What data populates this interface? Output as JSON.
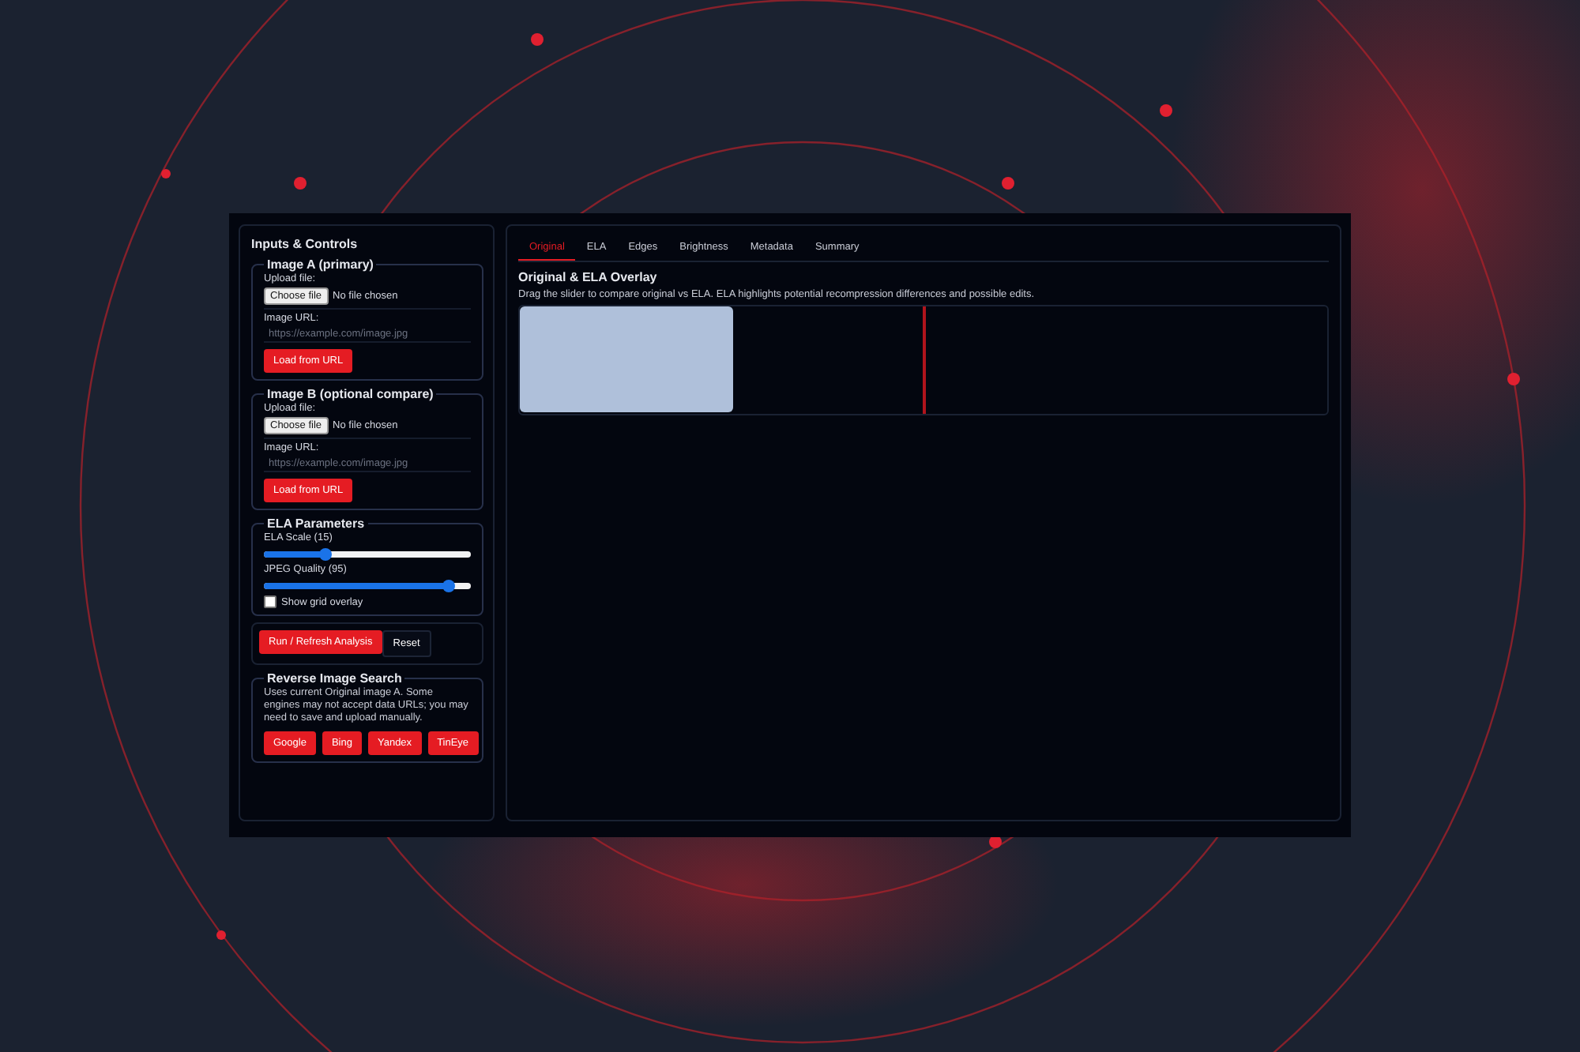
{
  "sidebar": {
    "title": "Inputs & Controls",
    "sources": [
      {
        "legend": "Image A (primary)",
        "upload_label": "Upload file:",
        "file_button": "Choose file",
        "file_status": "No file chosen",
        "url_label": "Image URL:",
        "url_placeholder": "https://example.com/image.jpg",
        "load_button": "Load from URL"
      },
      {
        "legend": "Image B (optional compare)",
        "upload_label": "Upload file:",
        "file_button": "Choose file",
        "file_status": "No file chosen",
        "url_label": "Image URL:",
        "url_placeholder": "https://example.com/image.jpg",
        "load_button": "Load from URL"
      }
    ],
    "ela": {
      "legend": "ELA Parameters",
      "sliders": [
        {
          "label": "ELA Scale (15)",
          "level": 0.3
        },
        {
          "label": "JPEG Quality (95)",
          "level": 0.89
        }
      ],
      "grid_overlay": {
        "label": "Show grid overlay",
        "checked": false
      }
    },
    "actions": [
      {
        "label": "Run / Refresh Analysis",
        "kind": "primary"
      },
      {
        "label": "Reset",
        "kind": "secondary"
      }
    ],
    "reverse_search": {
      "legend": "Reverse Image Search",
      "note": "Uses current Original image A. Some engines may not accept data URLs; you may need to save and upload manually.",
      "engines": [
        "Google",
        "Bing",
        "Yandex",
        "TinEye"
      ]
    }
  },
  "main": {
    "tabs": [
      {
        "label": "Original",
        "selected": true
      },
      {
        "label": "ELA",
        "selected": false
      },
      {
        "label": "Edges",
        "selected": false
      },
      {
        "label": "Brightness",
        "selected": false
      },
      {
        "label": "Metadata",
        "selected": false
      },
      {
        "label": "Summary",
        "selected": false
      }
    ],
    "title": "Original & ELA Overlay",
    "description": "Drag the slider to compare original vs ELA. ELA highlights potential recompression differences and possible edits.",
    "compare": {
      "level": 0.5
    }
  }
}
